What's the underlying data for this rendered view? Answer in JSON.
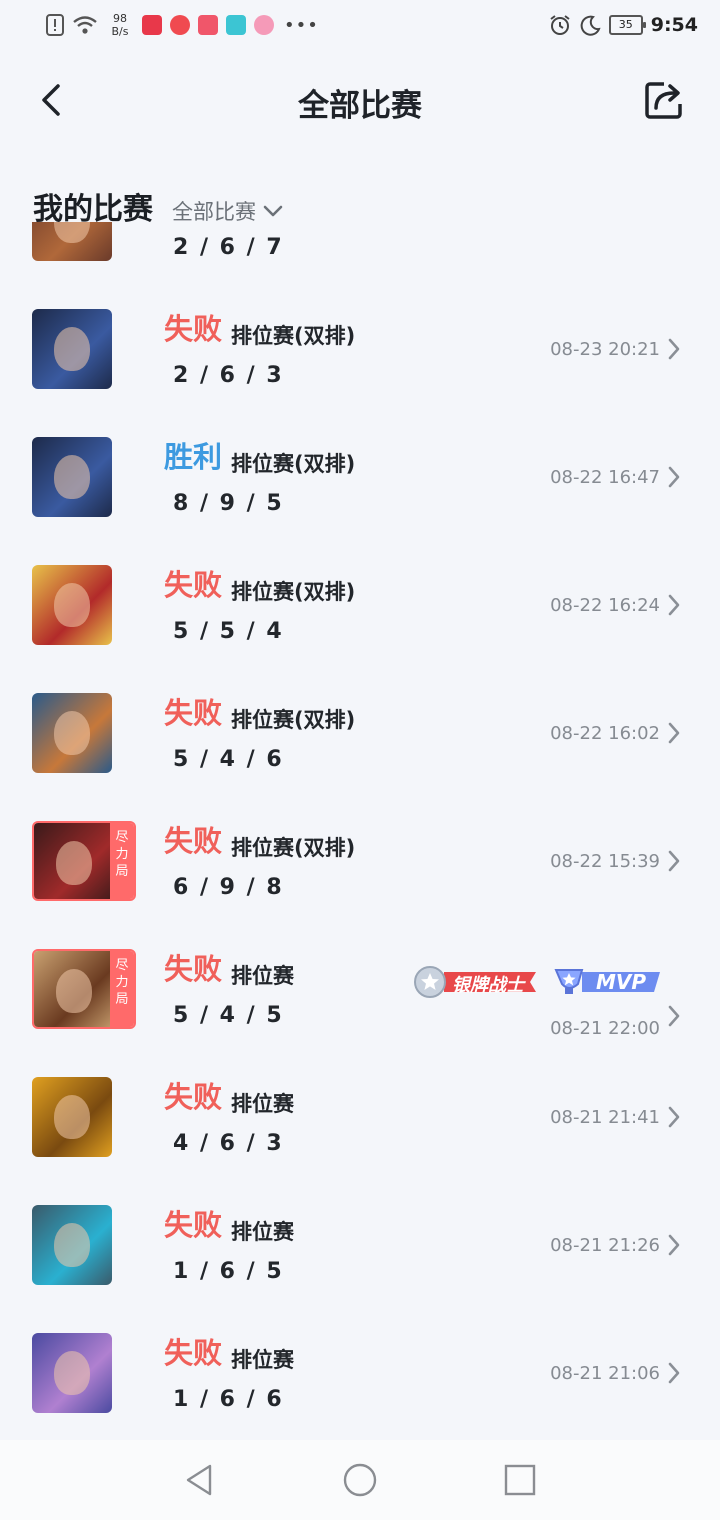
{
  "status_bar": {
    "net_speed_value": "98",
    "net_speed_unit": "B/s",
    "battery": "35",
    "time": "9:54",
    "icons": [
      "sim-alert-icon",
      "wifi-icon",
      "app-icon-1",
      "app-icon-2",
      "app-icon-3",
      "tap-icon",
      "app-icon-5",
      "more-icon",
      "alarm-icon",
      "moon-icon",
      "battery-icon"
    ]
  },
  "header": {
    "title": "全部比赛"
  },
  "section": {
    "title": "我的比赛",
    "filter_label": "全部比赛"
  },
  "matches": [
    {
      "result": "",
      "mode": "",
      "kda": "2 / 6 / 7",
      "time": "",
      "ribbon": "",
      "partial": true
    },
    {
      "result": "失败",
      "result_type": "lose",
      "mode": "排位赛(双排)",
      "kda": "2 / 6 / 3",
      "time": "08-23 20:21",
      "ribbon": ""
    },
    {
      "result": "胜利",
      "result_type": "win",
      "mode": "排位赛(双排)",
      "kda": "8 / 9 / 5",
      "time": "08-22 16:47",
      "ribbon": ""
    },
    {
      "result": "失败",
      "result_type": "lose",
      "mode": "排位赛(双排)",
      "kda": "5 / 5 / 4",
      "time": "08-22 16:24",
      "ribbon": ""
    },
    {
      "result": "失败",
      "result_type": "lose",
      "mode": "排位赛(双排)",
      "kda": "5 / 4 / 6",
      "time": "08-22 16:02",
      "ribbon": ""
    },
    {
      "result": "失败",
      "result_type": "lose",
      "mode": "排位赛(双排)",
      "kda": "6 / 9 / 8",
      "time": "08-22 15:39",
      "ribbon": "尽力局"
    },
    {
      "result": "失败",
      "result_type": "lose",
      "mode": "排位赛",
      "kda": "5 / 4 / 5",
      "time": "08-21 22:00",
      "ribbon": "尽力局",
      "badges": [
        "银牌战士",
        "MVP"
      ]
    },
    {
      "result": "失败",
      "result_type": "lose",
      "mode": "排位赛",
      "kda": "4 / 6 / 3",
      "time": "08-21 21:41",
      "ribbon": ""
    },
    {
      "result": "失败",
      "result_type": "lose",
      "mode": "排位赛",
      "kda": "1 / 6 / 5",
      "time": "08-21 21:26",
      "ribbon": ""
    },
    {
      "result": "失败",
      "result_type": "lose",
      "mode": "排位赛",
      "kda": "1 / 6 / 6",
      "time": "08-21 21:06",
      "ribbon": ""
    }
  ],
  "colors": {
    "lose": "#f0605a",
    "win": "#3d9ae0",
    "background": "#f4f6fa",
    "ribbon": "#ff6a6a"
  },
  "nav_bar": {
    "icons": [
      "back-triangle-icon",
      "home-circle-icon",
      "recents-square-icon"
    ]
  }
}
